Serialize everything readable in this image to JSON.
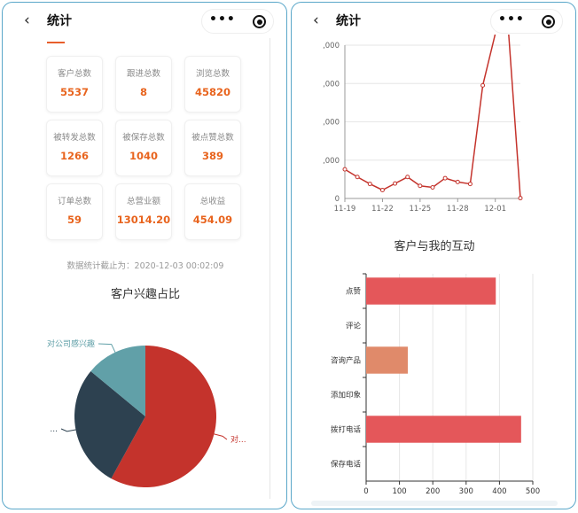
{
  "left_screen": {
    "nav": {
      "back_icon": "‹",
      "title": "统计",
      "more_icon": "•••",
      "close_icon": "target-icon"
    },
    "cards": [
      {
        "label": "客户总数",
        "value": "5537"
      },
      {
        "label": "跟进总数",
        "value": "8"
      },
      {
        "label": "浏览总数",
        "value": "45820"
      },
      {
        "label": "被转发总数",
        "value": "1266"
      },
      {
        "label": "被保存总数",
        "value": "1040"
      },
      {
        "label": "被点赞总数",
        "value": "389"
      },
      {
        "label": "订单总数",
        "value": "59"
      },
      {
        "label": "总营业额",
        "value": "13014.20"
      },
      {
        "label": "总收益",
        "value": "454.09"
      }
    ],
    "stamp": "数据统计截止为：2020-12-03 00:02:09",
    "pie_title": "客户兴趣占比"
  },
  "right_screen": {
    "nav": {
      "back_icon": "‹",
      "title": "统计",
      "more_icon": "•••",
      "close_icon": "target-icon"
    },
    "bar_title": "客户与我的互动"
  },
  "colors": {
    "accent": "#e8641e",
    "pie_red": "#c4332c",
    "pie_navy": "#2d4150",
    "pie_teal": "#61a0a8",
    "bar_red": "#e4575a",
    "bar_orange": "#e08a6a",
    "line": "#c4332c"
  },
  "chart_data": [
    {
      "type": "pie",
      "slices": [
        {
          "name": "对...",
          "value": 58
        },
        {
          "name": "...",
          "value": 28
        },
        {
          "name": "对公司感兴趣",
          "value": 14
        }
      ],
      "title": "客户兴趣占比"
    },
    {
      "type": "line",
      "x_ticks": [
        "11-19",
        "11-22",
        "11-25",
        "11-28",
        "12-01"
      ],
      "y_tick_labels": [
        ",000",
        ",000",
        ",000",
        ",000",
        "0"
      ],
      "points": [
        {
          "x": 0,
          "y": 760
        },
        {
          "x": 1,
          "y": 560
        },
        {
          "x": 2,
          "y": 380
        },
        {
          "x": 3,
          "y": 220
        },
        {
          "x": 4,
          "y": 390
        },
        {
          "x": 5,
          "y": 560
        },
        {
          "x": 6,
          "y": 330
        },
        {
          "x": 7,
          "y": 290
        },
        {
          "x": 8,
          "y": 530
        },
        {
          "x": 9,
          "y": 430
        },
        {
          "x": 10,
          "y": 380
        },
        {
          "x": 11,
          "y": 2950
        },
        {
          "x": 12,
          "y": 4300
        },
        {
          "x": 13,
          "y": 4600
        },
        {
          "x": 14,
          "y": 10
        }
      ],
      "ylim": [
        0,
        4000
      ]
    },
    {
      "type": "bar",
      "orientation": "horizontal",
      "title": "客户与我的互动",
      "categories": [
        "点赞",
        "评论",
        "咨询产品",
        "添加印象",
        "拨打电话",
        "保存电话"
      ],
      "values": [
        389,
        0,
        125,
        0,
        465,
        0
      ],
      "x_ticks": [
        "0",
        "100",
        "200",
        "300",
        "400",
        "500"
      ],
      "xlim": [
        0,
        500
      ]
    }
  ]
}
